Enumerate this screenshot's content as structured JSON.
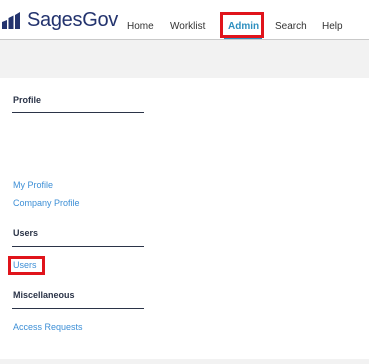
{
  "header": {
    "logo_text": "SagesGov",
    "nav": {
      "home": "Home",
      "worklist": "Worklist",
      "admin": "Admin",
      "search": "Search",
      "help": "Help"
    },
    "active_tab": "Admin"
  },
  "sections": {
    "profile": {
      "title": "Profile",
      "links": {
        "my_profile": "My Profile",
        "company_profile": "Company Profile"
      }
    },
    "users": {
      "title": "Users",
      "links": {
        "users": "Users"
      }
    },
    "miscellaneous": {
      "title": "Miscellaneous",
      "links": {
        "access_requests": "Access Requests"
      }
    }
  },
  "colors": {
    "brand": "#23336e",
    "accent": "#2e8fbf",
    "link": "#3d8fd6",
    "highlight_box": "#e0141b",
    "page_background": "#f2f2f2"
  }
}
